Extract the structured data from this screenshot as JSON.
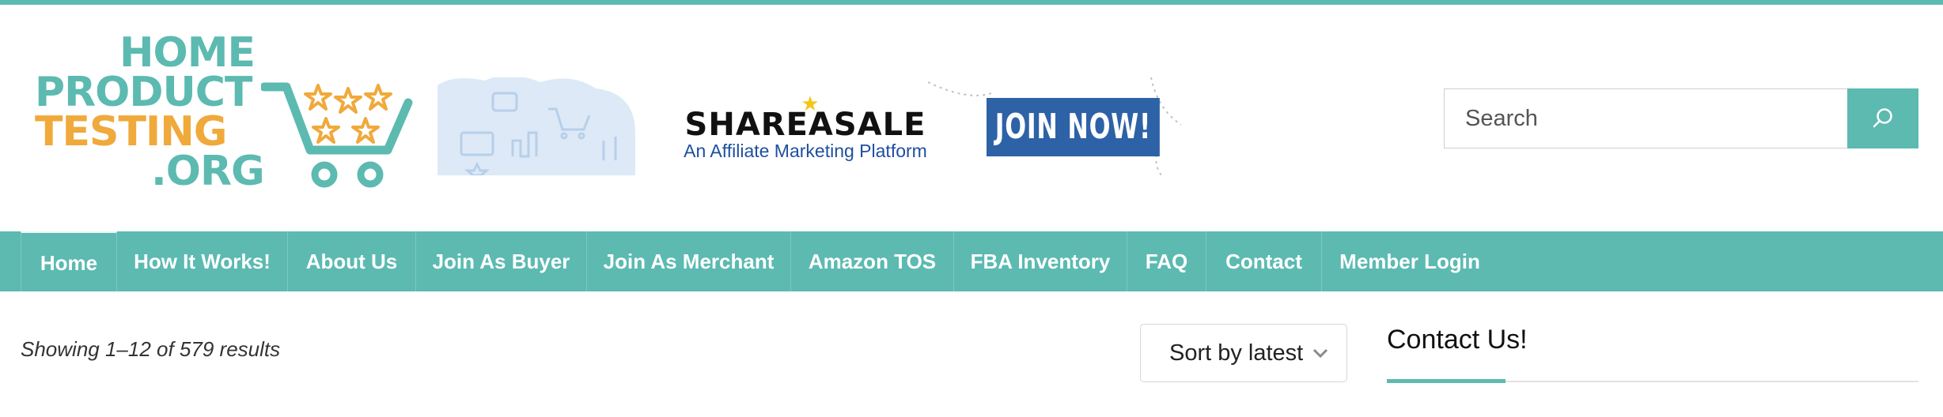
{
  "brand": {
    "logo_lines": [
      "HOME",
      "PRODUCT",
      "TESTING",
      ".ORG"
    ],
    "colors": {
      "teal": "#5cbab1",
      "orange": "#f0a93b",
      "blue": "#2d62a6"
    }
  },
  "banner": {
    "brand": "SHAREASALE",
    "tagline": "An Affiliate Marketing Platform",
    "cta": "JOIN NOW!"
  },
  "search": {
    "placeholder": "Search",
    "value": "",
    "icon": "search-icon"
  },
  "nav": {
    "items": [
      {
        "label": "Home",
        "active": true
      },
      {
        "label": "How It Works!"
      },
      {
        "label": "About Us"
      },
      {
        "label": "Join As Buyer"
      },
      {
        "label": "Join As Merchant"
      },
      {
        "label": "Amazon TOS"
      },
      {
        "label": "FBA Inventory"
      },
      {
        "label": "FAQ"
      },
      {
        "label": "Contact"
      },
      {
        "label": "Member Login"
      }
    ]
  },
  "shop": {
    "result_count": "Showing 1–12 of 579 results",
    "sort": {
      "selected": "Sort by latest",
      "icon": "chevron-down-icon"
    }
  },
  "sidebar": {
    "widget_title": "Contact Us!"
  }
}
